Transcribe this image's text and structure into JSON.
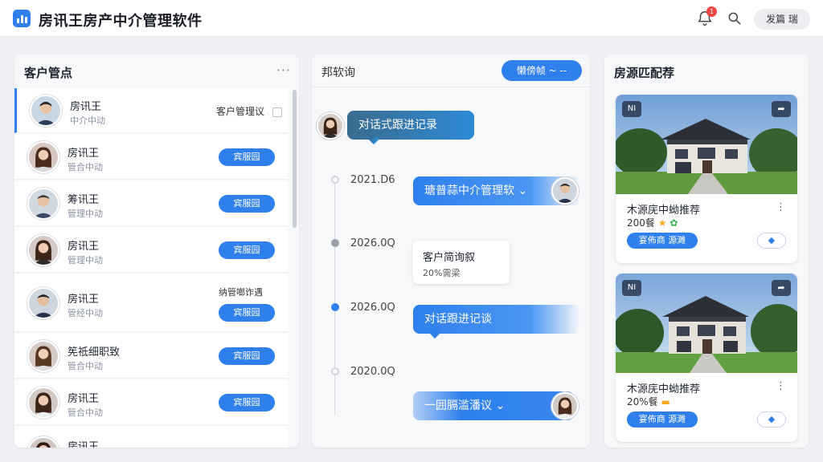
{
  "header": {
    "app_title": "房讯王房产中介管理软件",
    "notification_count": "1",
    "user_label": "发篇 瑞"
  },
  "left_panel": {
    "title": "客户管点",
    "more": "···",
    "clients": [
      {
        "name": "房讯王",
        "sub": "中介中动",
        "note": "客户管理议"
      },
      {
        "name": "房讯王",
        "sub": "管合中动",
        "button": "宾服园"
      },
      {
        "name": "筹讯王",
        "sub": "管理中动",
        "button": "宾服园"
      },
      {
        "name": "房讯王",
        "sub": "管理中动",
        "button": "宾服园"
      },
      {
        "name": "房讯王",
        "sub": "管经中动",
        "note": "纳管啷诈遇",
        "button": "宾服园"
      },
      {
        "name": "筅祗细职致",
        "sub": "管合中动",
        "button": "宾服园"
      },
      {
        "name": "房讯王",
        "sub": "管合中动",
        "button": "宾服园"
      },
      {
        "name": "房讯王",
        "sub": ""
      }
    ]
  },
  "middle_panel": {
    "title": "邦软询",
    "pill": "懒傍帧 ~ --",
    "header_bubble": "对话式跟进记录",
    "entries": [
      {
        "date": "2021.D6",
        "text": "瑭普蒜中介管理软  ⌄"
      },
      {
        "date": "2026.0Q",
        "card_title": "客户简询叙",
        "card_sub": "20%需梁"
      },
      {
        "date": "2026.0Q",
        "text": "对话跟进记谈"
      },
      {
        "date": "2020.0Q",
        "text": "一囲膈滥潘议    ⌄"
      }
    ]
  },
  "right_panel": {
    "title": "房源匹配荐",
    "cards": [
      {
        "tag": "NI",
        "share": "➦",
        "title": "木源庑中蚴推荐",
        "price": "200餐",
        "star": "★",
        "leaf": "✿",
        "menu": "⋮",
        "button": "宴佈商 源濉",
        "link": "◆"
      },
      {
        "tag": "NI",
        "share": "➦",
        "title": "木源庑中蚴推荐",
        "price": "20%餐",
        "star": "▬",
        "leaf": "",
        "menu": "⋮",
        "button": "宴佈商 源濉",
        "link": "◆"
      }
    ]
  },
  "colors": {
    "accent": "#2f80ed",
    "badge": "#ef4444",
    "panel_bg": "#f7f8fa",
    "page_bg": "#eef0f4"
  }
}
